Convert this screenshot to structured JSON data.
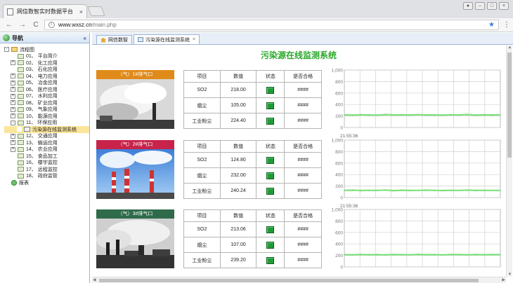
{
  "browser": {
    "tab_title": "网信数智实时数据平台",
    "tab_close": "×",
    "url_host": "www.wxsz.cn",
    "url_path": "/main.php",
    "back": "←",
    "forward": "→",
    "reload": "C",
    "star": "★",
    "menu": "⋮"
  },
  "sidebar": {
    "title": "导航",
    "collapse": "«",
    "tree": [
      {
        "label": "流程图",
        "level": 0,
        "exp": "-",
        "type": "folder"
      },
      {
        "label": "01、 平台简介",
        "level": 1,
        "exp": "",
        "type": "leaf"
      },
      {
        "label": "02、 化工应用",
        "level": 1,
        "exp": "+",
        "type": "leaf"
      },
      {
        "label": "03、 石化应用",
        "level": 1,
        "exp": "",
        "type": "leaf"
      },
      {
        "label": "04、 电力应用",
        "level": 1,
        "exp": "+",
        "type": "leaf"
      },
      {
        "label": "05、 冶金应用",
        "level": 1,
        "exp": "+",
        "type": "leaf"
      },
      {
        "label": "06、 医疗应用",
        "level": 1,
        "exp": "+",
        "type": "leaf"
      },
      {
        "label": "07、 水利应用",
        "level": 1,
        "exp": "+",
        "type": "leaf"
      },
      {
        "label": "08、 矿业应用",
        "level": 1,
        "exp": "+",
        "type": "leaf"
      },
      {
        "label": "09、 气象应用",
        "level": 1,
        "exp": "+",
        "type": "leaf"
      },
      {
        "label": "10、 能源应用",
        "level": 1,
        "exp": "+",
        "type": "leaf"
      },
      {
        "label": "11、 环保应用",
        "level": 1,
        "exp": "-",
        "type": "leaf"
      },
      {
        "label": "污染源在线监测系统",
        "level": 2,
        "exp": "",
        "type": "doc",
        "selected": true
      },
      {
        "label": "12、 交通应用",
        "level": 1,
        "exp": "+",
        "type": "leaf"
      },
      {
        "label": "13、 输运应用",
        "level": 1,
        "exp": "+",
        "type": "leaf"
      },
      {
        "label": "14、 农业应用",
        "level": 1,
        "exp": "+",
        "type": "leaf"
      },
      {
        "label": "15、 食品加工",
        "level": 1,
        "exp": "",
        "type": "leaf"
      },
      {
        "label": "16、 楼宇监控",
        "level": 1,
        "exp": "",
        "type": "leaf"
      },
      {
        "label": "17、 远程监控",
        "level": 1,
        "exp": "",
        "type": "leaf"
      },
      {
        "label": "18、 政府监管",
        "level": 1,
        "exp": "",
        "type": "leaf"
      },
      {
        "label": "报表",
        "level": 0,
        "exp": "",
        "type": "globe"
      }
    ]
  },
  "panel_tabs": [
    {
      "label": "网信数智",
      "icon": "home-icon",
      "active": false
    },
    {
      "label": "污染源在线监测系统",
      "icon": "grid-icon",
      "active": true,
      "close": "×"
    }
  ],
  "page_title": "污染源在线监测系统",
  "table_headers": [
    "项目",
    "数值",
    "状态",
    "是否合格"
  ],
  "stations": [
    {
      "label": "（气）1#排气口",
      "label_color": "#e08a1a",
      "rows": [
        {
          "item": "SO2",
          "value": "218.00",
          "qualified": "####"
        },
        {
          "item": "烟尘",
          "value": "105.00",
          "qualified": "####"
        },
        {
          "item": "工业粉尘",
          "value": "224.40",
          "qualified": "####"
        }
      ],
      "time": "21:55:36"
    },
    {
      "label": "（气）2#排气口",
      "label_color": "#c8234a",
      "rows": [
        {
          "item": "SO2",
          "value": "124.80",
          "qualified": "####"
        },
        {
          "item": "烟尘",
          "value": "232.00",
          "qualified": "####"
        },
        {
          "item": "工业粉尘",
          "value": "240.24",
          "qualified": "####"
        }
      ],
      "time": "21:55:36"
    },
    {
      "label": "（气）3#排气口",
      "label_color": "#2f6b4a",
      "rows": [
        {
          "item": "SO2",
          "value": "213.06",
          "qualified": "####"
        },
        {
          "item": "烟尘",
          "value": "107.00",
          "qualified": "####"
        },
        {
          "item": "工业粉尘",
          "value": "239.20",
          "qualified": "####"
        }
      ],
      "time": ""
    }
  ],
  "chart_data": [
    {
      "type": "line",
      "yticks": [
        "1,000",
        "800",
        "600",
        "400",
        "200",
        "0"
      ],
      "ylim": [
        0,
        1000
      ],
      "series": [
        {
          "values": [
            220,
            215,
            222,
            218,
            216,
            224,
            219,
            221,
            217,
            223,
            218,
            220,
            216,
            222,
            219,
            225,
            215,
            221,
            218,
            220
          ]
        }
      ]
    },
    {
      "type": "line",
      "yticks": [
        "1,000",
        "800",
        "600",
        "400",
        "200",
        "0"
      ],
      "ylim": [
        0,
        1000
      ],
      "series": [
        {
          "values": [
            125,
            128,
            122,
            126,
            124,
            130,
            121,
            127,
            123,
            125,
            128,
            124,
            122,
            126,
            125,
            129,
            123,
            126,
            124,
            125
          ]
        }
      ]
    },
    {
      "type": "line",
      "yticks": [
        "1,000",
        "800",
        "600",
        "400",
        "200",
        "0"
      ],
      "ylim": [
        0,
        1000
      ],
      "series": [
        {
          "values": [
            213,
            210,
            216,
            212,
            214,
            209,
            215,
            213,
            211,
            217,
            212,
            214,
            210,
            216,
            213,
            211,
            215,
            212,
            214,
            213
          ]
        }
      ]
    }
  ]
}
